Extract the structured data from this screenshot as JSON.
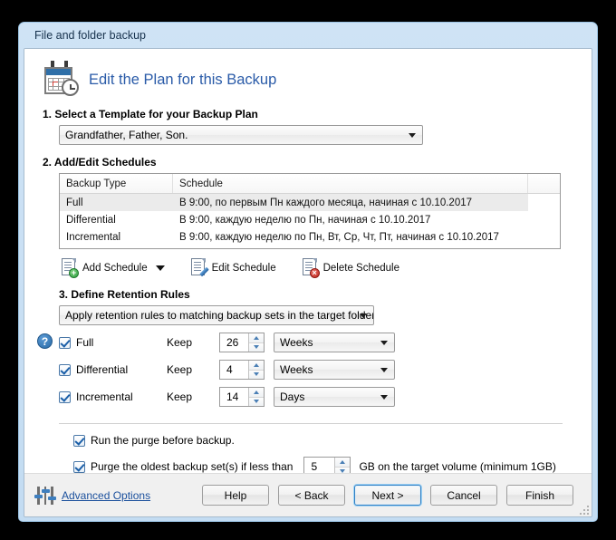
{
  "window": {
    "title": "File and folder backup"
  },
  "header": {
    "title": "Edit the Plan for this Backup",
    "icon": "calendar-clock-icon"
  },
  "step1": {
    "label": "1. Select a Template for your Backup Plan",
    "template_value": "Grandfather, Father, Son."
  },
  "step2": {
    "label": "2. Add/Edit Schedules",
    "columns": [
      "Backup Type",
      "Schedule"
    ],
    "rows": [
      {
        "type": "Full",
        "schedule": "В 9:00, по первым Пн каждого месяца, начиная с 10.10.2017",
        "selected": true
      },
      {
        "type": "Differential",
        "schedule": "В 9:00, каждую неделю по Пн, начиная с 10.10.2017",
        "selected": false
      },
      {
        "type": "Incremental",
        "schedule": "В 9:00, каждую неделю по Пн, Вт, Ср, Чт, Пт, начиная с 10.10.2017",
        "selected": false
      }
    ],
    "actions": [
      {
        "label": "Add Schedule",
        "icon": "document-add-icon",
        "has_dropdown": true
      },
      {
        "label": "Edit Schedule",
        "icon": "document-edit-icon",
        "has_dropdown": false
      },
      {
        "label": "Delete Schedule",
        "icon": "document-delete-icon",
        "has_dropdown": false
      }
    ]
  },
  "step3": {
    "label": "3. Define Retention Rules",
    "help_icon": "?",
    "scope_value": "Apply retention rules to matching backup sets in the target folder",
    "keep_label": "Keep",
    "rules": [
      {
        "name": "Full",
        "checked": true,
        "amount": "26",
        "unit": "Weeks"
      },
      {
        "name": "Differential",
        "checked": true,
        "amount": "4",
        "unit": "Weeks"
      },
      {
        "name": "Incremental",
        "checked": true,
        "amount": "14",
        "unit": "Days"
      }
    ]
  },
  "purge": {
    "run_before_label": "Run the purge before backup.",
    "run_before_checked": true,
    "oldest_prefix": "Purge the oldest backup set(s) if less than",
    "oldest_checked": true,
    "oldest_value": "5",
    "oldest_suffix": "GB on the target volume (minimum 1GB)"
  },
  "footer": {
    "advanced_label": "Advanced Options",
    "advanced_icon": "sliders-icon",
    "buttons": [
      {
        "label": "Help",
        "default": false
      },
      {
        "label": "< Back",
        "default": false
      },
      {
        "label": "Next >",
        "default": true
      },
      {
        "label": "Cancel",
        "default": false
      },
      {
        "label": "Finish",
        "default": false
      }
    ]
  },
  "colors": {
    "accent": "#2a5ba8",
    "title_bar": "#c3dcf2",
    "link": "#1a4f9c",
    "focus": "#2f7fc4"
  }
}
